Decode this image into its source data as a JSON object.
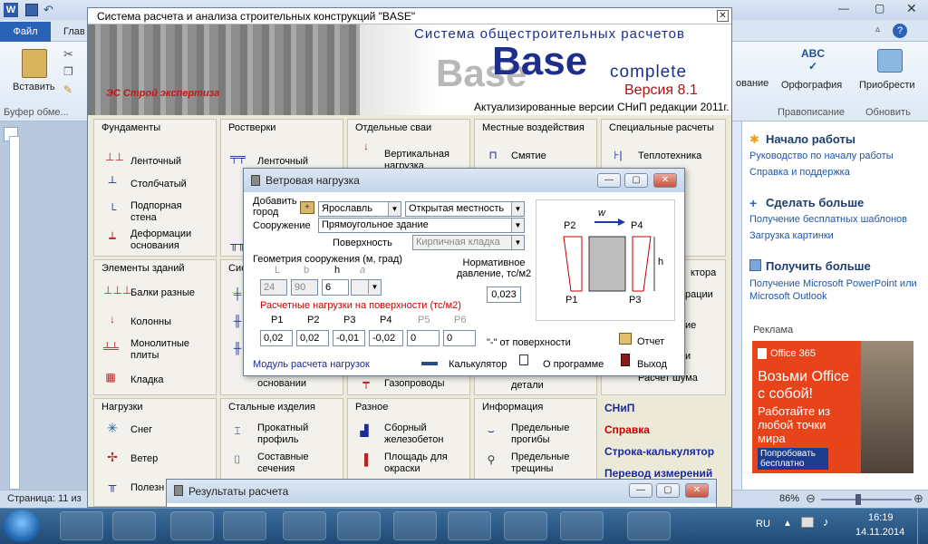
{
  "word": {
    "tabs": {
      "file": "Файл",
      "home": "Глав"
    },
    "ribbon": {
      "paste": "Вставить",
      "clipboard_group": "Буфер обме...",
      "dict_partial": "ование",
      "spelling": "Орфография",
      "proofing_group": "Правописание",
      "addins": "Приобрести",
      "update_group": "Обновить"
    },
    "status_page": "Страница: 11 из",
    "zoom": "86%",
    "taskpane": {
      "start_header": "Начало работы",
      "start_links": [
        "Руководство по началу работы",
        "Справка и поддержка"
      ],
      "more_header": "Сделать больше",
      "more_links": [
        "Получение бесплатных шаблонов",
        "Загрузка картинки"
      ],
      "get_header": "Получить больше",
      "get_link": "Получение Microsoft PowerPoint или Microsoft Outlook",
      "ad_label": "Реклама",
      "ad_brand": "Office 365",
      "ad_title": "Возьми Office с собой!",
      "ad_text": "Работайте из любой точки мира",
      "ad_button": "Попробовать бесплатно"
    }
  },
  "base": {
    "title": "Система расчета и анализа строительных конструкций  \"BASE\"",
    "banner": {
      "system": "Система общестроительных расчетов",
      "base": "Base",
      "complete": "complete",
      "version": "Версия 8.1",
      "snip": "Актуализированные версии СНиП редакции 2011г.",
      "logo": "ЭС Строй экспертиза"
    },
    "panels": {
      "foundations": {
        "title": "Фундаменты",
        "items": [
          "Ленточный",
          "Столбчатый",
          "Подпорная стена",
          "Деформации основания"
        ]
      },
      "grillages": {
        "title": "Ростверки",
        "items": [
          "Ленточный"
        ]
      },
      "piles": {
        "title": "Отдельные сваи",
        "items": [
          "Вертикальная нагрузка"
        ]
      },
      "local": {
        "title": "Местные воздействия",
        "items": [
          "Смятие"
        ]
      },
      "special": {
        "title": "Специальные расчеты",
        "items": [
          "Теплотехника"
        ]
      },
      "elements": {
        "title": "Элементы зданий",
        "items": [
          "Балки разные",
          "Колонны",
          "Монолитные плиты",
          "Кладка"
        ]
      },
      "loads": {
        "title": "Нагрузки",
        "items": [
          "Снег",
          "Ветер",
          "Полезн"
        ]
      },
      "steel": {
        "title": "Стальные изделия",
        "items": [
          "Прокатный профиль",
          "Составные сечения"
        ]
      },
      "misc": {
        "title": "Разное",
        "items": [
          "Сборный железобетон",
          "Площадь для окраски",
          "Газопроводы"
        ]
      },
      "info": {
        "title": "Информация",
        "items": [
          "Предельные прогибы",
          "Предельные трещины"
        ]
      },
      "partial": {
        "a": "Сис",
        "b": "ктора",
        "c": "рации",
        "d": "ие",
        "e": "и",
        "f": "Расчет шума",
        "g": "детали",
        "h": "основании"
      },
      "links": [
        "СНиП",
        "Справка",
        "Строка-калькулятор",
        "Перевод измерений"
      ]
    }
  },
  "dialog": {
    "title": "Ветровая нагрузка",
    "add_city": "Добавить город",
    "city": "Ярославль",
    "terrain": "Открытая местность",
    "structure_label": "Сооружение",
    "structure": "Прямоугольное здание",
    "surface_label": "Поверхность",
    "surface": "Кирпичная кладка",
    "geometry_label": "Геометрия сооружения (м, град)",
    "geometry_headers": [
      "L",
      "b",
      "h",
      "a"
    ],
    "geometry_values": [
      "24",
      "90",
      "6",
      ""
    ],
    "norm_label": "Нормативное давление, тс/м2",
    "norm_value": "0,023",
    "design_label": "Расчетные нагрузки на поверхности  (тс/м2)",
    "p_headers": [
      "P1",
      "P2",
      "P3",
      "P4",
      "P5",
      "P6"
    ],
    "p_values": [
      "0,02",
      "0,02",
      "-0,01",
      "-0,02",
      "0",
      "0"
    ],
    "sign_note": "\"-\" от поверхности",
    "report": "Отчет",
    "module": "Модуль расчета нагрузок",
    "calculator": "Калькулятор",
    "about": "О программе",
    "exit": "Выход",
    "diagram": {
      "w": "w",
      "p1": "P1",
      "p2": "P2",
      "p3": "P3",
      "p4": "P4",
      "h": "h"
    }
  },
  "results": {
    "title": "Результаты расчета"
  },
  "taskbar": {
    "lang": "RU",
    "time": "16:19",
    "date": "14.11.2014"
  }
}
